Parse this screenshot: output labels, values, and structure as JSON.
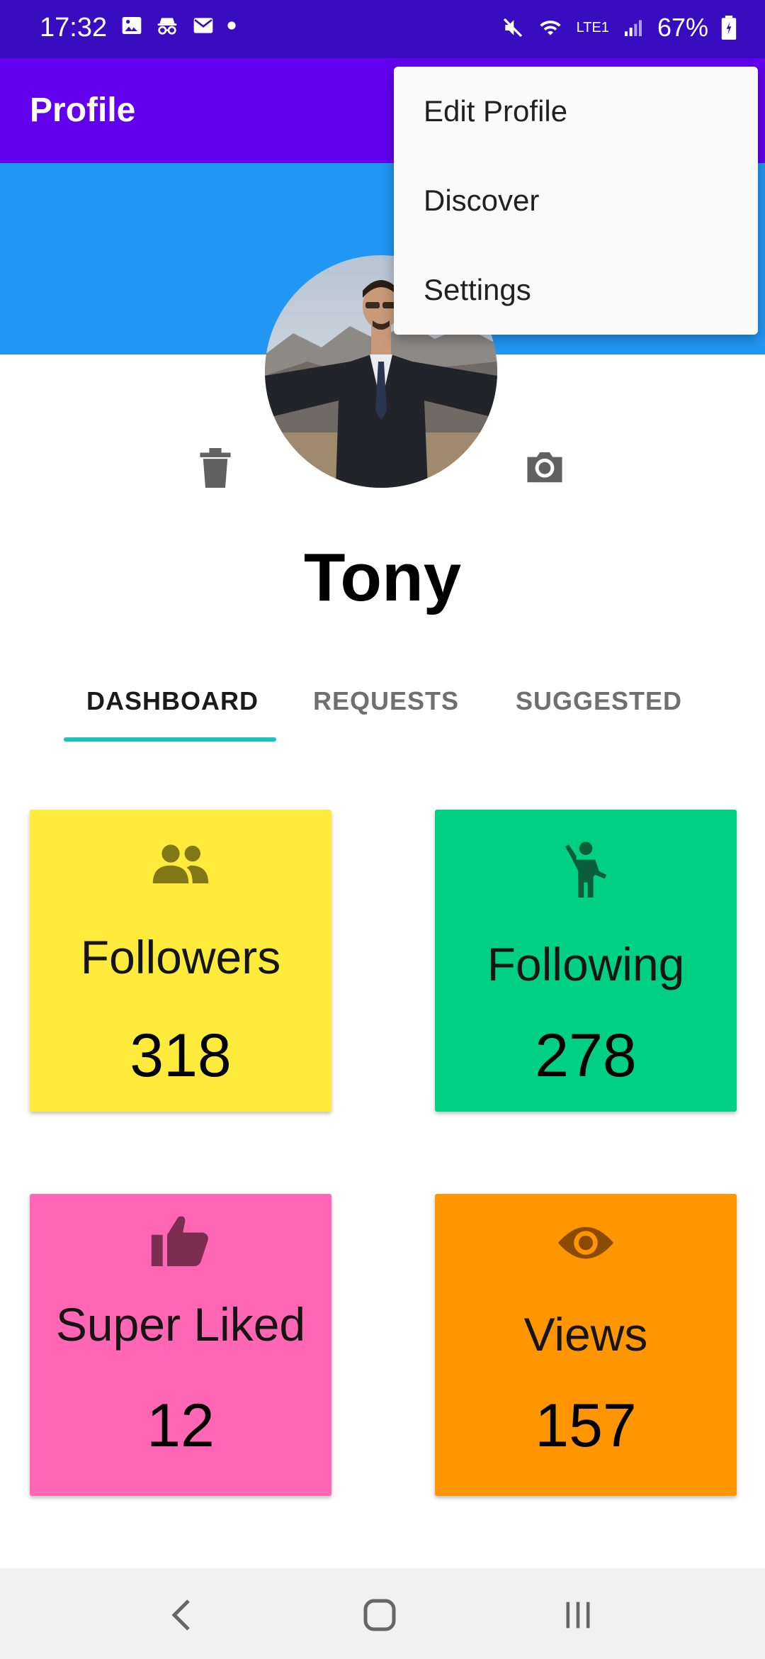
{
  "status_bar": {
    "time": "17:32",
    "battery": "67%",
    "network": "LTE1"
  },
  "app_bar": {
    "title": "Profile"
  },
  "menu": {
    "items": [
      {
        "label": "Edit Profile"
      },
      {
        "label": "Discover"
      },
      {
        "label": "Settings"
      }
    ]
  },
  "profile": {
    "name": "Tony",
    "icons": {
      "delete": "trash-icon",
      "camera": "camera-icon"
    }
  },
  "tabs": [
    {
      "label": "DASHBOARD",
      "active": true
    },
    {
      "label": "REQUESTS",
      "active": false
    },
    {
      "label": "SUGGESTED",
      "active": false
    }
  ],
  "cards": [
    {
      "label": "Followers",
      "value": "318",
      "icon": "people-icon",
      "color": "#ffeb3b",
      "icon_color": "#827717"
    },
    {
      "label": "Following",
      "value": "278",
      "icon": "person-waving-icon",
      "color": "#00d084",
      "icon_color": "#0b5e3a"
    },
    {
      "label": "Super Liked",
      "value": "12",
      "icon": "thumbs-up-icon",
      "color": "#ff66b3",
      "icon_color": "#7b2d52"
    },
    {
      "label": "Views",
      "value": "157",
      "icon": "eye-icon",
      "color": "#ff9500",
      "icon_color": "#8a4a00"
    }
  ],
  "colors": {
    "status_bar": "#3a0cbf",
    "app_bar": "#6200ee",
    "banner": "#2196f3",
    "tab_indicator": "#1ac6b7"
  }
}
